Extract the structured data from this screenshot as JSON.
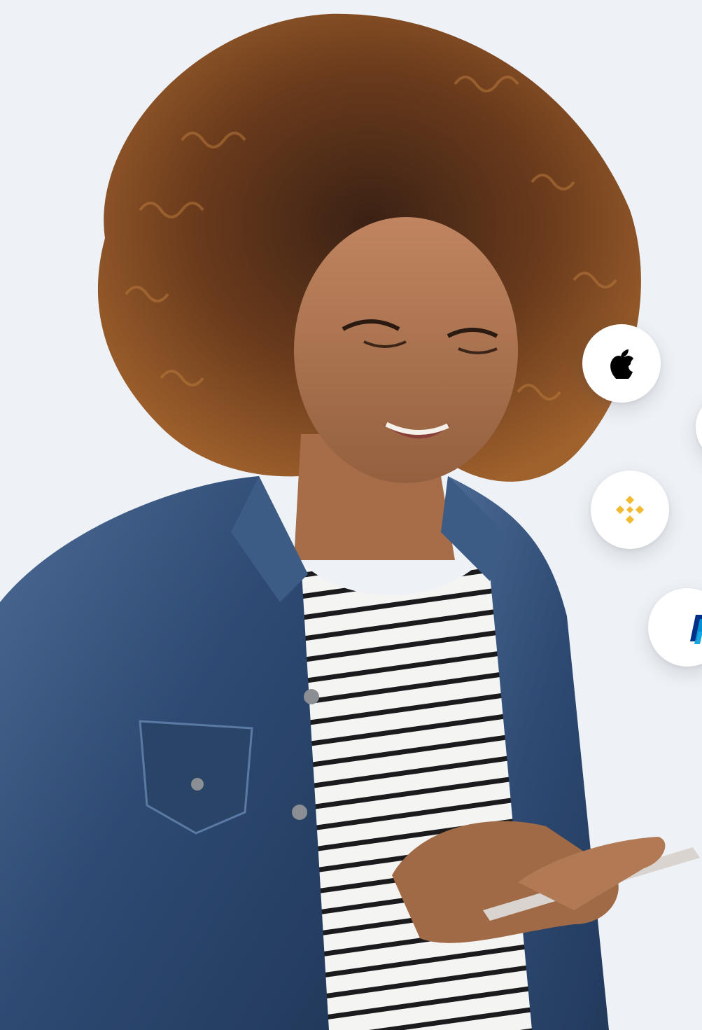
{
  "hero": {
    "photo": "smiling-woman-with-phone"
  },
  "payment_badges": [
    {
      "name": "apple",
      "icon": "apple-icon",
      "color": "#000000"
    },
    {
      "name": "unknown",
      "icon": "partial-badge",
      "color": "#ffffff"
    },
    {
      "name": "binance",
      "icon": "binance-icon",
      "color": "#F3BA2F"
    },
    {
      "name": "paypal",
      "icon": "paypal-icon",
      "colors": [
        "#003087",
        "#009CDE"
      ]
    }
  ]
}
